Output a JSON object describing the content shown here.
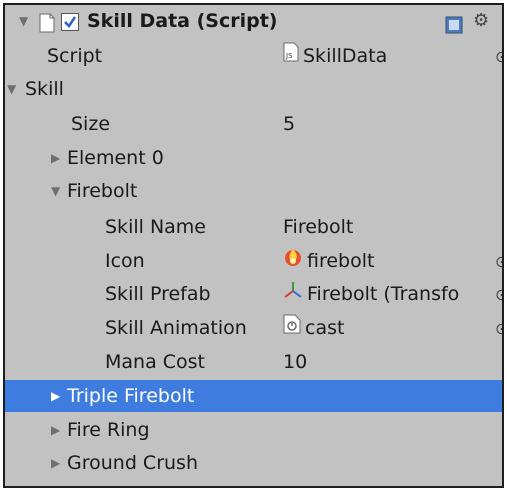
{
  "header": {
    "title": "Skill Data (Script)",
    "enabled": true,
    "icons": [
      "help-book-icon",
      "gear-icon"
    ]
  },
  "script_field": {
    "label": "Script",
    "value": "SkillData",
    "icon": "javascript-file-icon"
  },
  "skill": {
    "label": "Skill",
    "size_label": "Size",
    "size_value": "5",
    "elements": [
      {
        "label": "Element 0",
        "expanded": false
      },
      {
        "label": "Firebolt",
        "expanded": true,
        "fields": [
          {
            "label": "Skill Name",
            "value": "Firebolt"
          },
          {
            "label": "Icon",
            "value": "firebolt",
            "icon": "fire-icon"
          },
          {
            "label": "Skill Prefab",
            "value": "Firebolt (Transfo",
            "icon": "transform-icon"
          },
          {
            "label": "Skill Animation",
            "value": "cast",
            "icon": "animation-clip-icon"
          },
          {
            "label": "Mana Cost",
            "value": "10"
          }
        ]
      },
      {
        "label": "Triple Firebolt",
        "expanded": false,
        "selected": true
      },
      {
        "label": "Fire Ring",
        "expanded": false
      },
      {
        "label": "Ground Crush",
        "expanded": false
      }
    ]
  },
  "colors": {
    "panel_bg": "#c2c2c2",
    "selection": "#3e7ce0",
    "border": "#1e1e1e"
  }
}
